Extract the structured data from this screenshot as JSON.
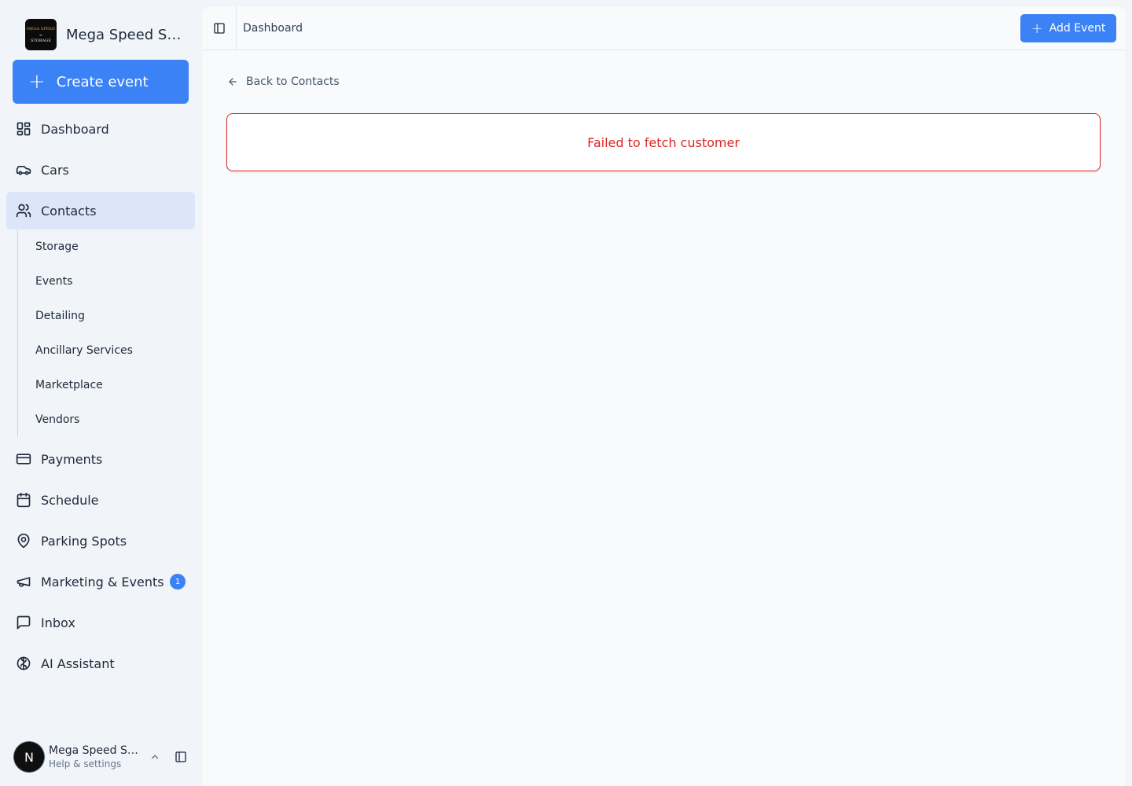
{
  "brand": {
    "name": "Mega Speed St...",
    "logo_text": [
      "MEGA SPEED",
      "⌁",
      "STORAGE"
    ]
  },
  "sidebar": {
    "create_label": "Create event",
    "items": [
      {
        "label": "Dashboard",
        "icon": "dashboard-icon"
      },
      {
        "label": "Cars",
        "icon": "car-icon"
      },
      {
        "label": "Contacts",
        "icon": "users-icon",
        "active": true
      },
      {
        "label": "Payments",
        "icon": "credit-card-icon"
      },
      {
        "label": "Schedule",
        "icon": "calendar-icon"
      },
      {
        "label": "Parking Spots",
        "icon": "map-pin-icon"
      },
      {
        "label": "Marketing & Events",
        "icon": "megaphone-icon",
        "badge": "1"
      },
      {
        "label": "Inbox",
        "icon": "message-square-icon"
      },
      {
        "label": "AI Assistant",
        "icon": "brain-icon"
      }
    ],
    "sub_items": [
      "Storage",
      "Events",
      "Detailing",
      "Ancillary Services",
      "Marketplace",
      "Vendors"
    ],
    "footer": {
      "avatar_initial": "N",
      "name": "Mega Speed St...",
      "subtitle": "Help & settings"
    }
  },
  "header": {
    "breadcrumb": "Dashboard",
    "add_label": "Add Event"
  },
  "content": {
    "back_label": "Back to Contacts",
    "error_message": "Failed to fetch customer"
  },
  "colors": {
    "accent": "#3b82f6",
    "active_bg": "#dbe6fb",
    "error": "#dc2626"
  }
}
